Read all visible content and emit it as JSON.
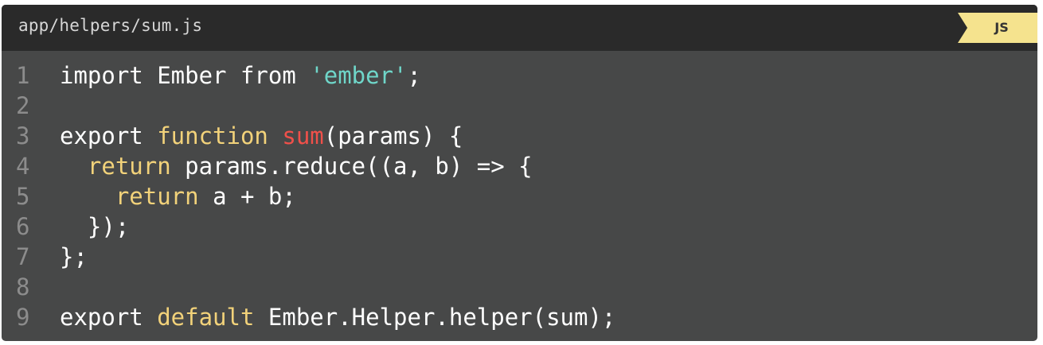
{
  "file": {
    "path": "app/helpers/sum.js",
    "language": "JS"
  },
  "colors": {
    "header_bg": "#2a2a2a",
    "code_bg": "#474848",
    "tag_bg": "#f5e38e",
    "plain": "#ffffff",
    "keyword": "#f2d27a",
    "string": "#6fd6c9",
    "function_name": "#f0504a",
    "line_number": "#8c8c8c"
  },
  "lines": [
    {
      "num": "1",
      "tokens": [
        {
          "t": "import Ember from ",
          "k": "plain"
        },
        {
          "t": "'ember'",
          "k": "string"
        },
        {
          "t": ";",
          "k": "plain"
        }
      ]
    },
    {
      "num": "2",
      "tokens": []
    },
    {
      "num": "3",
      "tokens": [
        {
          "t": "export ",
          "k": "plain"
        },
        {
          "t": "function",
          "k": "keyword"
        },
        {
          "t": " ",
          "k": "plain"
        },
        {
          "t": "sum",
          "k": "fn"
        },
        {
          "t": "(params) {",
          "k": "plain"
        }
      ]
    },
    {
      "num": "4",
      "tokens": [
        {
          "t": "  ",
          "k": "plain"
        },
        {
          "t": "return",
          "k": "keyword"
        },
        {
          "t": " params.reduce((a, b) => {",
          "k": "plain"
        }
      ]
    },
    {
      "num": "5",
      "tokens": [
        {
          "t": "    ",
          "k": "plain"
        },
        {
          "t": "return",
          "k": "keyword"
        },
        {
          "t": " a + b;",
          "k": "plain"
        }
      ]
    },
    {
      "num": "6",
      "tokens": [
        {
          "t": "  });",
          "k": "plain"
        }
      ]
    },
    {
      "num": "7",
      "tokens": [
        {
          "t": "};",
          "k": "plain"
        }
      ]
    },
    {
      "num": "8",
      "tokens": []
    },
    {
      "num": "9",
      "tokens": [
        {
          "t": "export ",
          "k": "plain"
        },
        {
          "t": "default",
          "k": "keyword"
        },
        {
          "t": " Ember.Helper.helper(sum);",
          "k": "plain"
        }
      ]
    }
  ]
}
